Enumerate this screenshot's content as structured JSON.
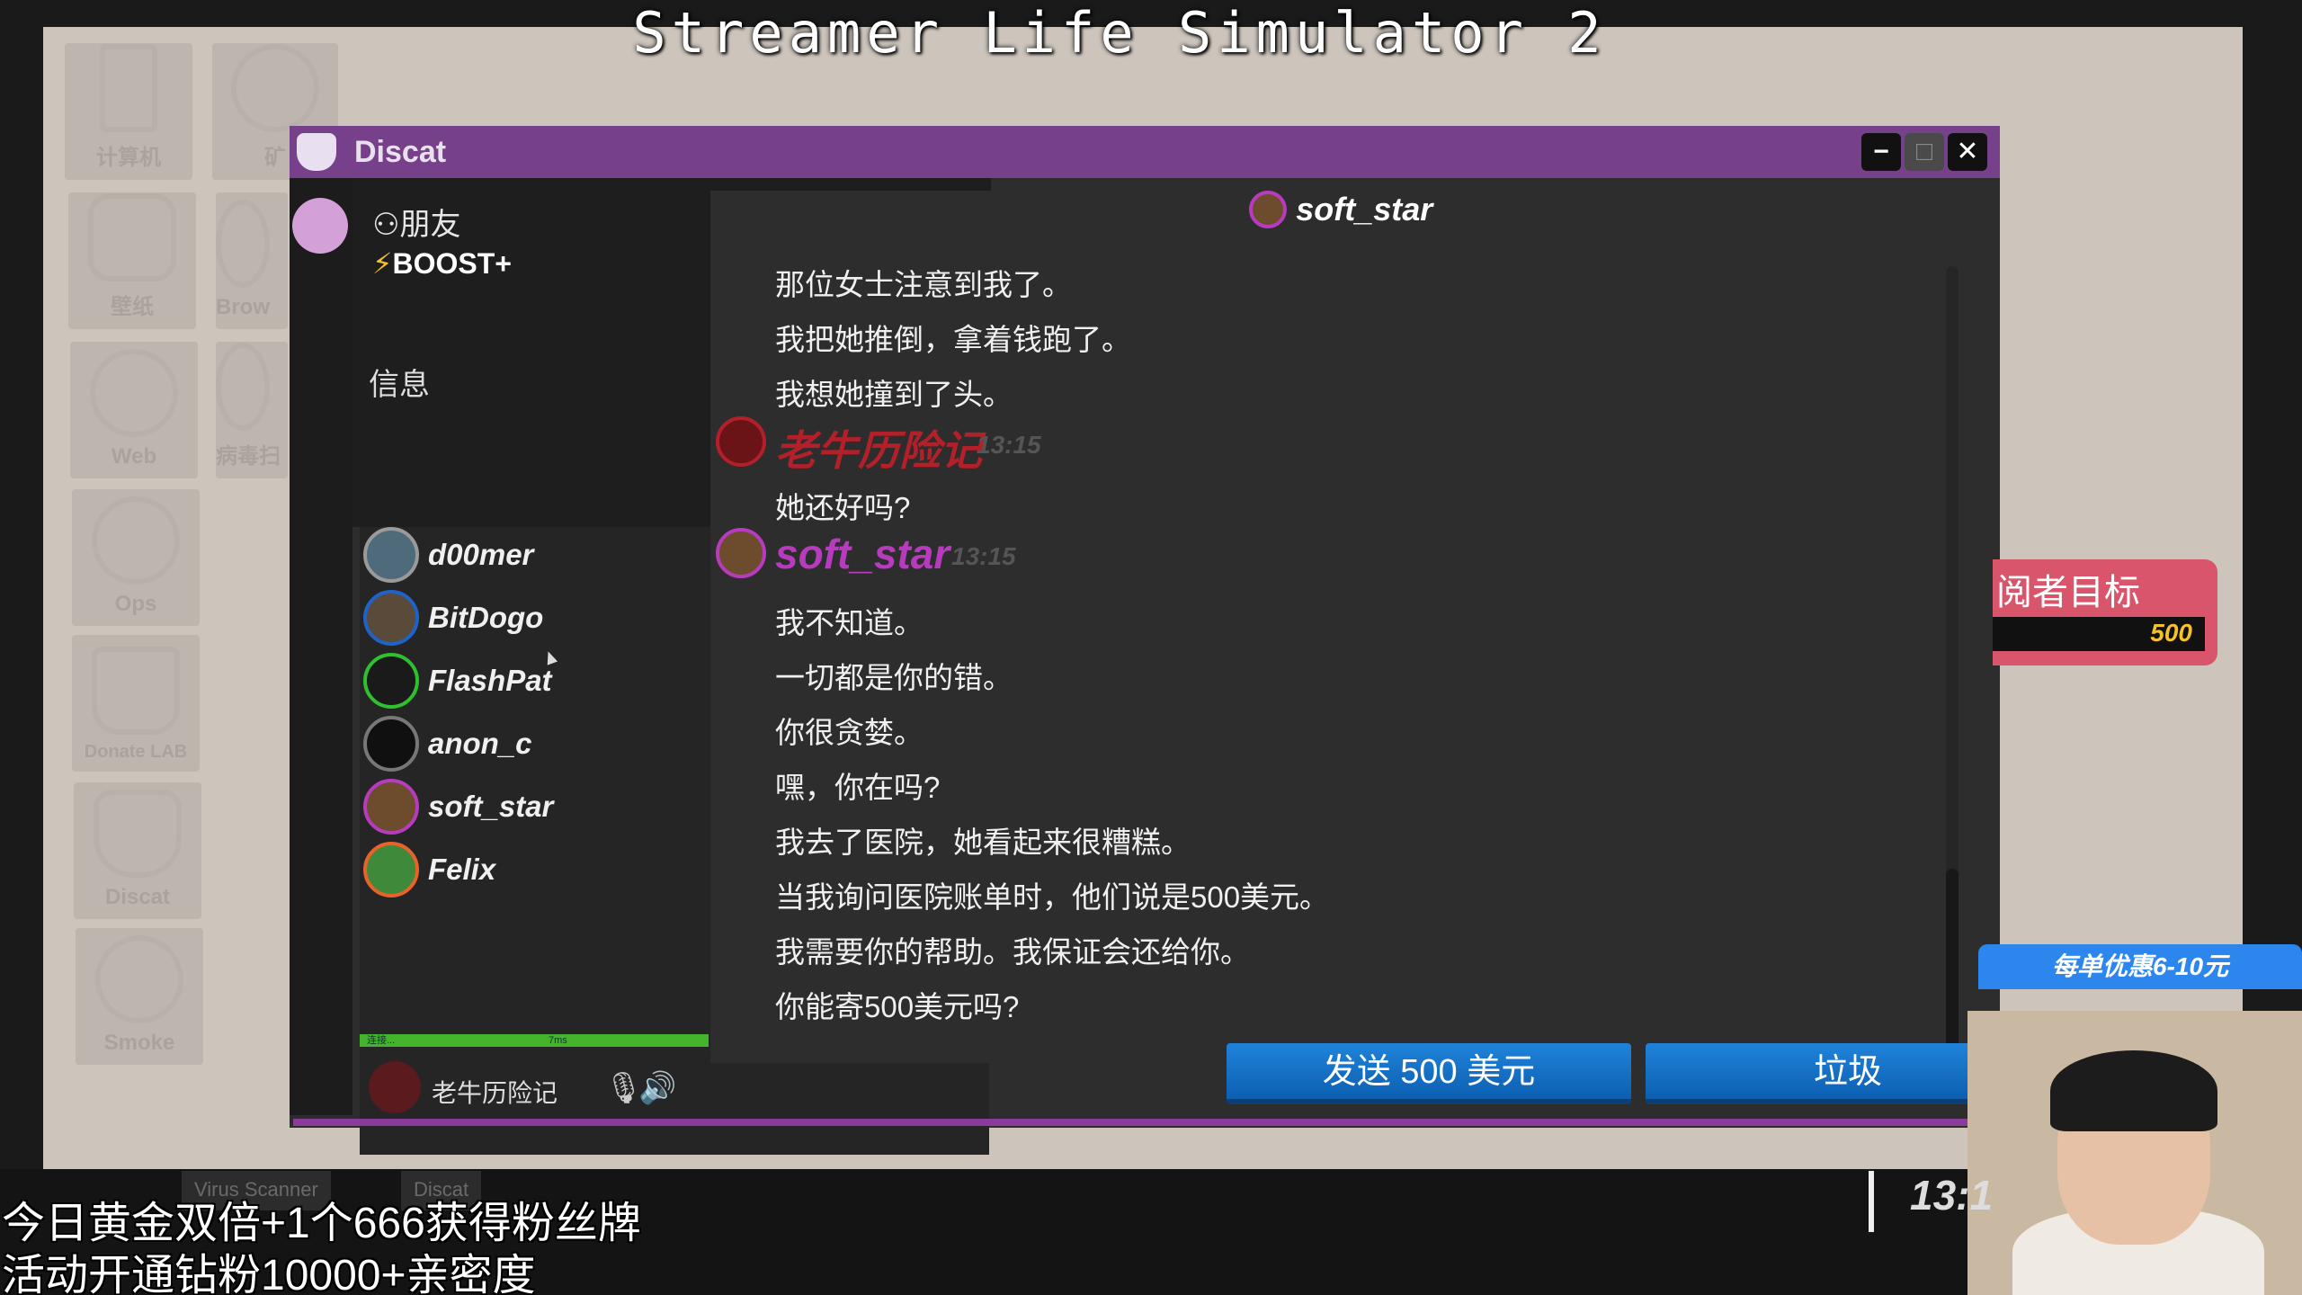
{
  "stream_title": "Streamer Life Simulator 2",
  "desktop": {
    "icons": [
      {
        "label": "计算机",
        "icon": "computer-icon"
      },
      {
        "label": "矿",
        "icon": "mining-icon"
      },
      {
        "label": "壁纸",
        "icon": "wallpaper-icon"
      },
      {
        "label": "Brow",
        "icon": "browser-icon"
      },
      {
        "label": "Web",
        "icon": "globe-icon"
      },
      {
        "label": "病毒扫",
        "icon": "bug-icon"
      },
      {
        "label": "Ops",
        "icon": "ops-icon"
      },
      {
        "label": "Donate LAB",
        "icon": "flask-icon"
      },
      {
        "label": "Discat",
        "icon": "cat-icon"
      },
      {
        "label": "Smoke",
        "icon": "smoke-icon"
      }
    ]
  },
  "window": {
    "title": "Discat",
    "controls": {
      "minimize": "−",
      "maximize": "□",
      "close": "✕"
    }
  },
  "sidebar": {
    "friends_label": "朋友",
    "boost_label": "BOOST+",
    "messages_header": "信息",
    "contacts": [
      {
        "name": "d00mer",
        "ring": "#9a9a9a",
        "fill": "#4f6a7a"
      },
      {
        "name": "BitDogo",
        "ring": "#1f63c9",
        "fill": "#5a4a3a"
      },
      {
        "name": "FlashPat",
        "ring": "#2ec12e",
        "fill": "#1a1a1a"
      },
      {
        "name": "anon_c",
        "ring": "#777777",
        "fill": "#101010"
      },
      {
        "name": "soft_star",
        "ring": "#b63bbd",
        "fill": "#6c4c2d"
      },
      {
        "name": "Felix",
        "ring": "#e8622a",
        "fill": "#3f8a3a"
      }
    ],
    "connection": {
      "status": "连接...",
      "ping": "7ms"
    },
    "current_user": "老牛历险记"
  },
  "chat": {
    "header_name": "soft_star",
    "lines_top": [
      "那位女士注意到我了。",
      "我把她推倒，拿着钱跑了。",
      "我想她撞到了头。"
    ],
    "author1": {
      "name": "老牛历险记",
      "time": "13:15",
      "color": "#b3202a"
    },
    "lines_mid": [
      "她还好吗?"
    ],
    "author2": {
      "name": "soft_star",
      "time": "13:15",
      "color": "#b63bbd"
    },
    "lines_bottom": [
      "我不知道。",
      "一切都是你的错。",
      "你很贪婪。",
      "嘿，你在吗?",
      "我去了医院，她看起来很糟糕。",
      "当我询问医院账单时，他们说是500美元。",
      "我需要你的帮助。我保证会还给你。",
      "你能寄500美元吗?"
    ],
    "actions": {
      "send": "发送 500 美元",
      "trash": "垃圾"
    }
  },
  "overlay": {
    "goal_title": "阅者目标",
    "goal_value": "500",
    "promo": "每单优惠6-10元",
    "banner_lines": [
      "今日黄金双倍+1个666获得粉丝牌",
      "活动开通钻粉10000+亲密度"
    ]
  },
  "taskbar": {
    "items": [
      "Virus Scanner",
      "Discat"
    ],
    "clock": "13:1"
  }
}
